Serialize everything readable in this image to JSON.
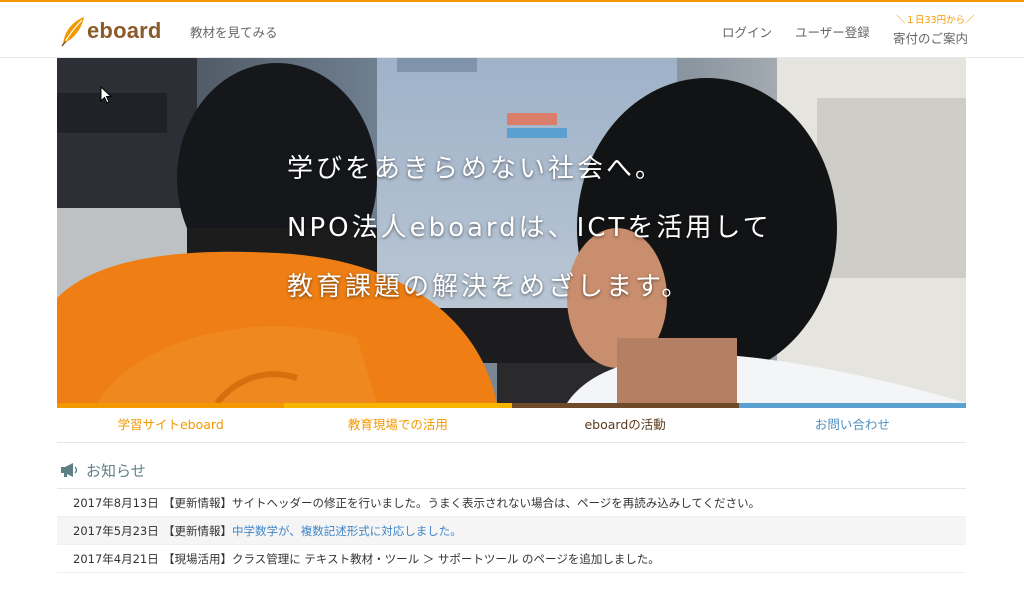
{
  "header": {
    "logo_text": "eboard",
    "nav_materials": "教材を見てみる",
    "nav_login": "ログイン",
    "nav_register": "ユーザー登録",
    "donate_note": "＼１日33円から／",
    "donate_label": "寄付のご案内"
  },
  "hero": {
    "lines": [
      "学びをあきらめない社会へ。",
      "NPO法人eboardは、ICTを活用して",
      "教育課題の解決をめざします。"
    ]
  },
  "tabs": [
    {
      "label": "学習サイトeboard",
      "color": "#f39800"
    },
    {
      "label": "教育現場での活用",
      "color": "#f8b500"
    },
    {
      "label": "eboardの活動",
      "color": "#6e4a2b"
    },
    {
      "label": "お問い合わせ",
      "color": "#5aa0d0"
    }
  ],
  "news": {
    "title": "お知らせ",
    "items": [
      {
        "date": "2017年8月13日",
        "text": "【更新情報】サイトヘッダーの修正を行いました。うまく表示されない場合は、ページを再読み込みしてください。",
        "prefix": "",
        "link": ""
      },
      {
        "date": "2017年5月23日",
        "text": "",
        "prefix": "【更新情報】",
        "link": "中学数学が、複数記述形式に対応しました。"
      },
      {
        "date": "2017年4月21日",
        "text": "【現場活用】クラス管理に テキスト教材・ツール ＞ サポートツール のページを追加しました。",
        "prefix": "",
        "link": ""
      }
    ]
  },
  "icons": [
    "leaf-logo-icon",
    "megaphone-icon",
    "mouse-cursor-icon"
  ]
}
